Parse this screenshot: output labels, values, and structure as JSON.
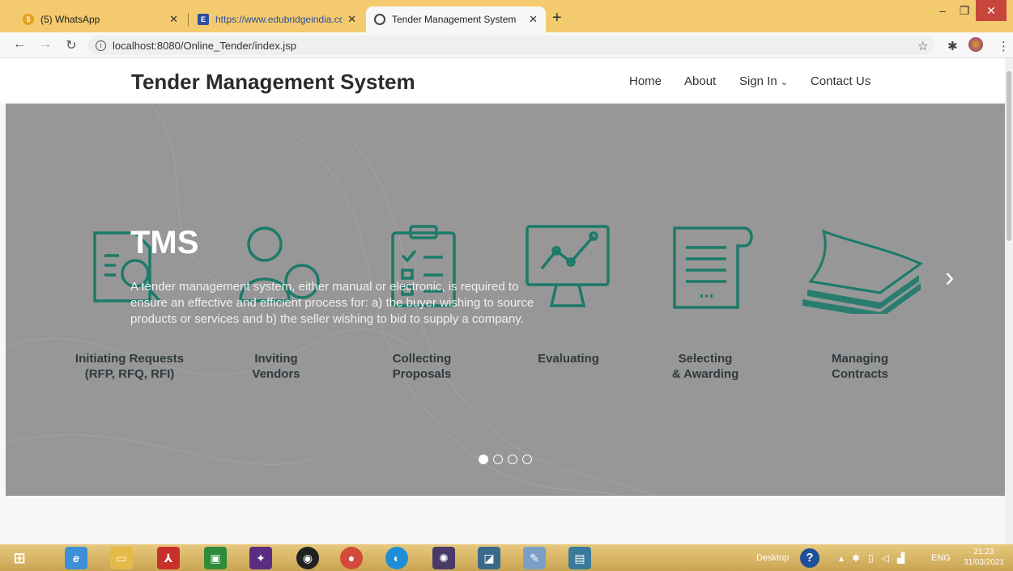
{
  "browser": {
    "tabs": [
      {
        "title": "(5) WhatsApp",
        "favicon": "whatsapp-icon",
        "active": false
      },
      {
        "title": "https://www.edubridgeindia.com",
        "favicon": "edubridge-icon",
        "active": false
      },
      {
        "title": "Tender Management System",
        "favicon": "globe-icon",
        "active": true
      }
    ],
    "url": "localhost:8080/Online_Tender/index.jsp",
    "new_tab_label": "+"
  },
  "site": {
    "brand": "Tender Management System",
    "nav": {
      "home": "Home",
      "about": "About",
      "sign_in": "Sign In",
      "contact": "Contact Us"
    }
  },
  "hero": {
    "title": "TMS",
    "text": "A tender management system, either manual or electronic, is required to ensure an effective and efficient process for: a) the buyer wishing to source products or services and b) the seller wishing to bid to supply a company.",
    "steps": [
      {
        "line1": "Initiating Requests",
        "line2": "(RFP, RFQ, RFI)"
      },
      {
        "line1": "Inviting",
        "line2": "Vendors"
      },
      {
        "line1": "Collecting",
        "line2": "Proposals"
      },
      {
        "line1": "Evaluating",
        "line2": ""
      },
      {
        "line1": "Selecting",
        "line2": "& Awarding"
      },
      {
        "line1": "Managing",
        "line2": "Contracts"
      }
    ],
    "slide_count": 4,
    "active_slide": 1,
    "icon_color": "#1c7a6a"
  },
  "taskbar": {
    "desktop_label": "Desktop",
    "lang": "ENG",
    "time": "21:23",
    "date": "31/03/2021"
  }
}
